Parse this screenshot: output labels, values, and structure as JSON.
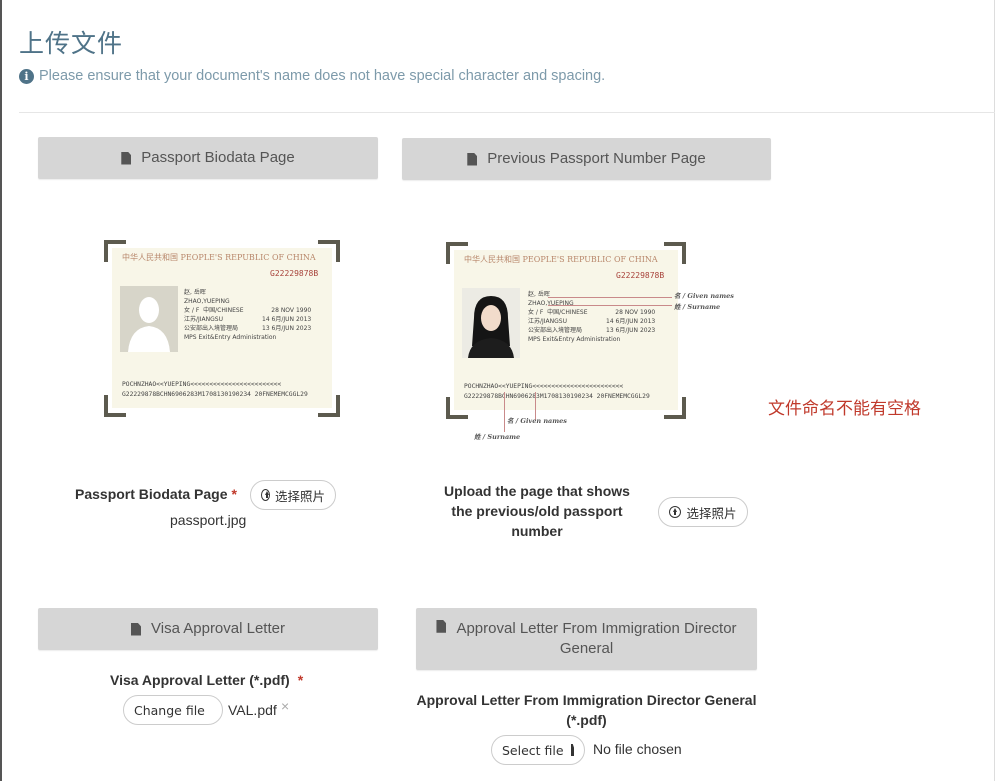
{
  "page": {
    "title": "上传文件",
    "notice": "Please ensure that your document's name does not have special character and spacing.",
    "notice_icon": "info-icon",
    "red_note": "文件命名不能有空格",
    "colors": {
      "title": "#4f7388",
      "notice": "#7d9aaa",
      "panel": "#d6d6d6",
      "required": "#c0392b"
    }
  },
  "sections": {
    "biodata": {
      "header": "Passport Biodata Page",
      "label": "Passport Biodata Page",
      "required_mark": "*",
      "button": "选择照片",
      "filename": "passport.jpg"
    },
    "previous": {
      "header": "Previous Passport Number Page",
      "label_line1": "Upload the page that shows",
      "label_line2": "the previous/old passport number",
      "button": "选择照片"
    },
    "visa": {
      "header": "Visa Approval Letter",
      "label": "Visa Approval Letter (*.pdf)",
      "required_mark": "*",
      "button": "Change file",
      "filename": "VAL.pdf",
      "remove": "×"
    },
    "approval": {
      "header_line1": "Approval Letter From Immigration Director",
      "header_line2": "General",
      "label_line1": "Approval Letter From Immigration Director General",
      "label_line2": "(*.pdf)",
      "button": "Select file",
      "status": "No file chosen"
    }
  },
  "sample_passport": {
    "country_cn": "中华人民共和国",
    "country_en": "PEOPLE'S REPUBLIC OF CHINA",
    "number": "G22229878B",
    "name_cn": "赵, 岳晖",
    "name_en": "ZHAO,YUEPING",
    "sex": "女 / F",
    "nationality": "中国/CHINESE",
    "dob": "28 NOV 1990",
    "birthplace": "江苏/JIANGSU",
    "issue_date": "14 6月/JUN 2013",
    "expiry": "13 6月/JUN 2023",
    "authority_cn": "公安部出入境管理局",
    "authority_en": "MPS Exit&Entry Administration",
    "mrz1": "POCHNZHAO<<YUEPING<<<<<<<<<<<<<<<<<<<<<<<<",
    "mrz2": "G22229878BCHN6906283M1708130190234 20FNEMEMCGGL29",
    "annotation_given": "名 / Given names",
    "annotation_surname": "姓 / Surname"
  }
}
